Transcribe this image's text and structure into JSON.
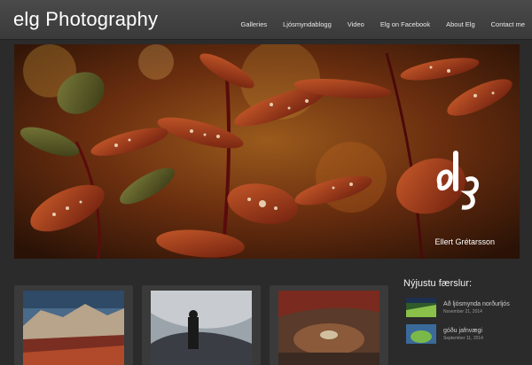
{
  "site": {
    "title": "elg Photography"
  },
  "nav": {
    "items": [
      {
        "label": "Galleries"
      },
      {
        "label": "Ljósmyndablogg"
      },
      {
        "label": "Video"
      },
      {
        "label": "Elg on Facebook"
      },
      {
        "label": "About Elg"
      },
      {
        "label": "Contact me"
      }
    ]
  },
  "hero": {
    "logo_text": "Elg",
    "photographer": "Ellert Grétarsson"
  },
  "sidebar": {
    "heading": "Nýjustu færslur:",
    "posts": [
      {
        "title": "Að ljósmynda norðurljós",
        "date": "November 21, 2014"
      },
      {
        "title": "góðu jafnvægi",
        "date": "September 11, 2014"
      }
    ]
  },
  "colors": {
    "background": "#2b2b2b",
    "header": "#3f3f3f",
    "text": "#ffffff"
  }
}
